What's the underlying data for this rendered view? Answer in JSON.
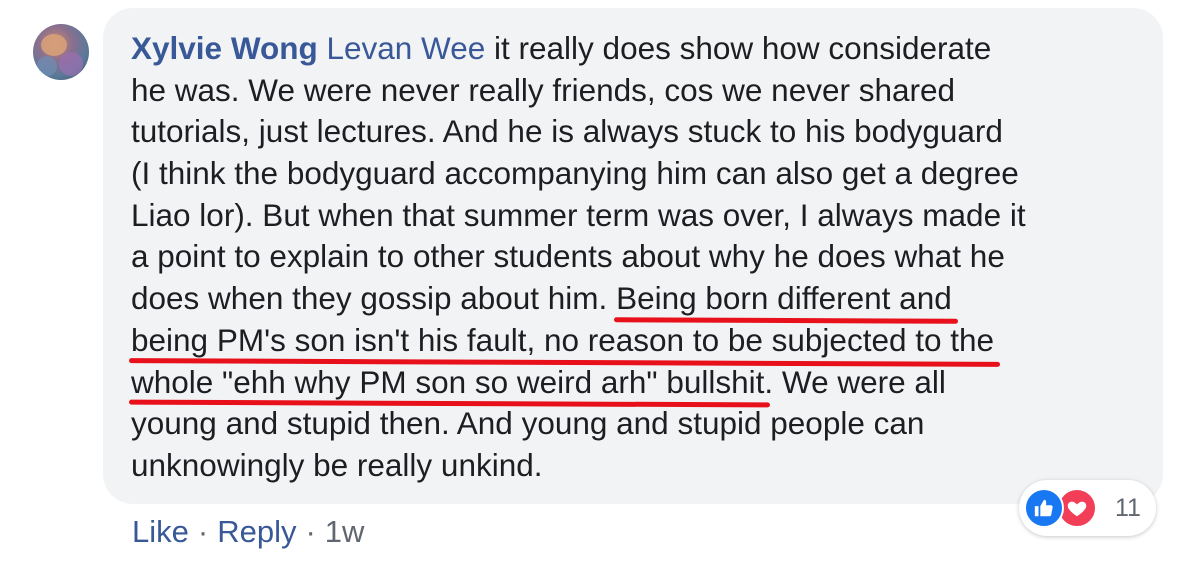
{
  "comment": {
    "author": "Xylvie Wong",
    "mention": "Levan Wee",
    "lines": [
      " it really does show how considerate",
      "he was. We were never really friends, cos we never shared",
      "tutorials, just lectures. And he is always stuck to his bodyguard",
      "(I think the bodyguard accompanying him can also get a degree",
      "Liao lor). But when that summer term was over, I always made it",
      "a point to explain to other students about why he does what he",
      "does when they gossip about him. ",
      "being PM's son isn't his fault, no reason to be subjected to the",
      "whole \"ehh why PM son so weird arh\" bullshit",
      ". We were all",
      "young and stupid then. And young and stupid people can",
      "unknowingly be really unkind."
    ],
    "highlight_start": "Being born different and",
    "underline_color": "#e8101a"
  },
  "actions": {
    "like": "Like",
    "separator": "·",
    "reply": "Reply",
    "time": "1w"
  },
  "reactions": {
    "icons": [
      "like-icon",
      "love-icon"
    ],
    "count": "11",
    "like_color": "#1877f2",
    "love_color": "#f33e58"
  },
  "colors": {
    "bubble": "#f2f3f5",
    "link": "#385898",
    "text": "#1c1e21",
    "meta": "#606770"
  }
}
